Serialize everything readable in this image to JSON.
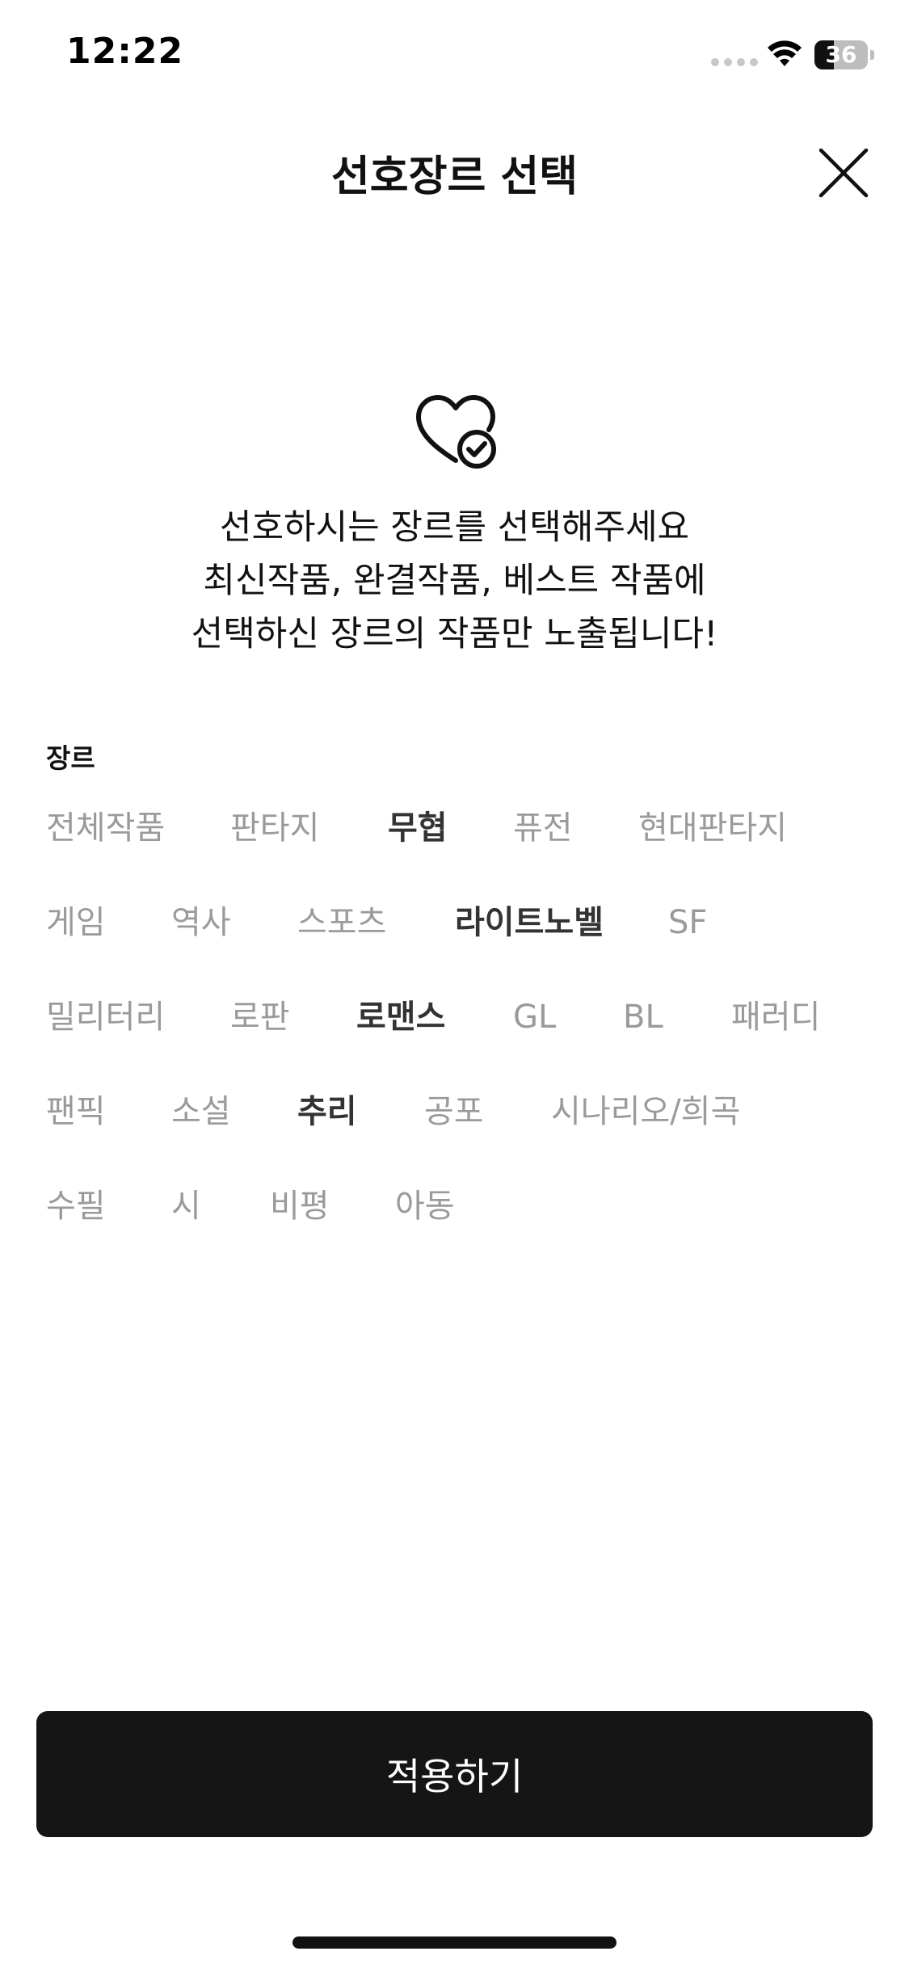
{
  "status_bar": {
    "time": "12:22",
    "battery_level": "36",
    "battery_fraction": 0.36
  },
  "header": {
    "title": "선호장르 선택",
    "close_icon": "close-icon"
  },
  "hero": {
    "icon": "heart-check-icon",
    "lines": [
      "선호하시는 장르를 선택해주세요",
      "최신작품, 완결작품, 베스트 작품에",
      "선택하신 장르의 작품만 노출됩니다!"
    ]
  },
  "genres": {
    "label": "장르",
    "rows": [
      [
        {
          "label": "전체작품",
          "selected": false
        },
        {
          "label": "판타지",
          "selected": false
        },
        {
          "label": "무협",
          "selected": true
        },
        {
          "label": "퓨전",
          "selected": false
        },
        {
          "label": "현대판타지",
          "selected": false
        }
      ],
      [
        {
          "label": "게임",
          "selected": false
        },
        {
          "label": "역사",
          "selected": false
        },
        {
          "label": "스포츠",
          "selected": false
        },
        {
          "label": "라이트노벨",
          "selected": true
        },
        {
          "label": "SF",
          "selected": false
        }
      ],
      [
        {
          "label": "밀리터리",
          "selected": false
        },
        {
          "label": "로판",
          "selected": false
        },
        {
          "label": "로맨스",
          "selected": true
        },
        {
          "label": "GL",
          "selected": false
        },
        {
          "label": "BL",
          "selected": false
        },
        {
          "label": "패러디",
          "selected": false
        }
      ],
      [
        {
          "label": "팬픽",
          "selected": false
        },
        {
          "label": "소설",
          "selected": false
        },
        {
          "label": "추리",
          "selected": true
        },
        {
          "label": "공포",
          "selected": false
        },
        {
          "label": "시나리오/희곡",
          "selected": false
        }
      ],
      [
        {
          "label": "수필",
          "selected": false
        },
        {
          "label": "시",
          "selected": false
        },
        {
          "label": "비평",
          "selected": false
        },
        {
          "label": "아동",
          "selected": false
        }
      ]
    ]
  },
  "apply_button": {
    "label": "적용하기"
  },
  "colors": {
    "selected_text": "#333333",
    "unselected_text": "#9a9a9a",
    "button_bg": "#151515",
    "button_text": "#ffffff"
  }
}
